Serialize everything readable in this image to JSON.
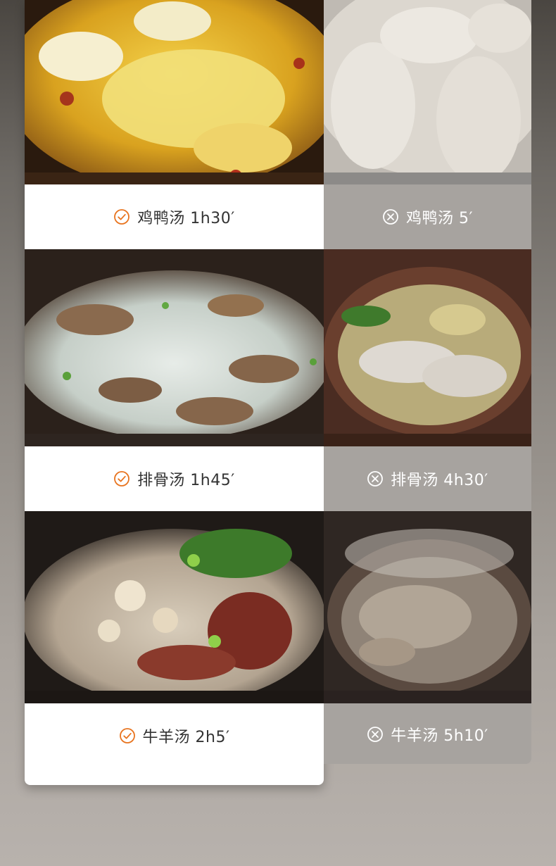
{
  "colors": {
    "good_accent": "#e8741f",
    "bad_panel": "#a7a39f",
    "good_panel": "#ffffff",
    "background": "#8f8a84"
  },
  "left_column": {
    "icon": "check-circle-icon",
    "items": [
      {
        "photo": "chicken-duck-soup-photo",
        "label": "鸡鸭汤 1h30′"
      },
      {
        "photo": "pork-rib-soup-photo",
        "label": "排骨汤 1h45′"
      },
      {
        "photo": "beef-mutton-soup-photo",
        "label": "牛羊汤  2h5′"
      }
    ]
  },
  "right_column": {
    "icon": "x-circle-icon",
    "items": [
      {
        "photo": "chicken-duck-soup-photo",
        "label": "鸡鸭汤 5′"
      },
      {
        "photo": "pork-rib-soup-photo",
        "label": "排骨汤 4h30′"
      },
      {
        "photo": "beef-mutton-soup-photo",
        "label": "牛羊汤 5h10′"
      }
    ]
  }
}
